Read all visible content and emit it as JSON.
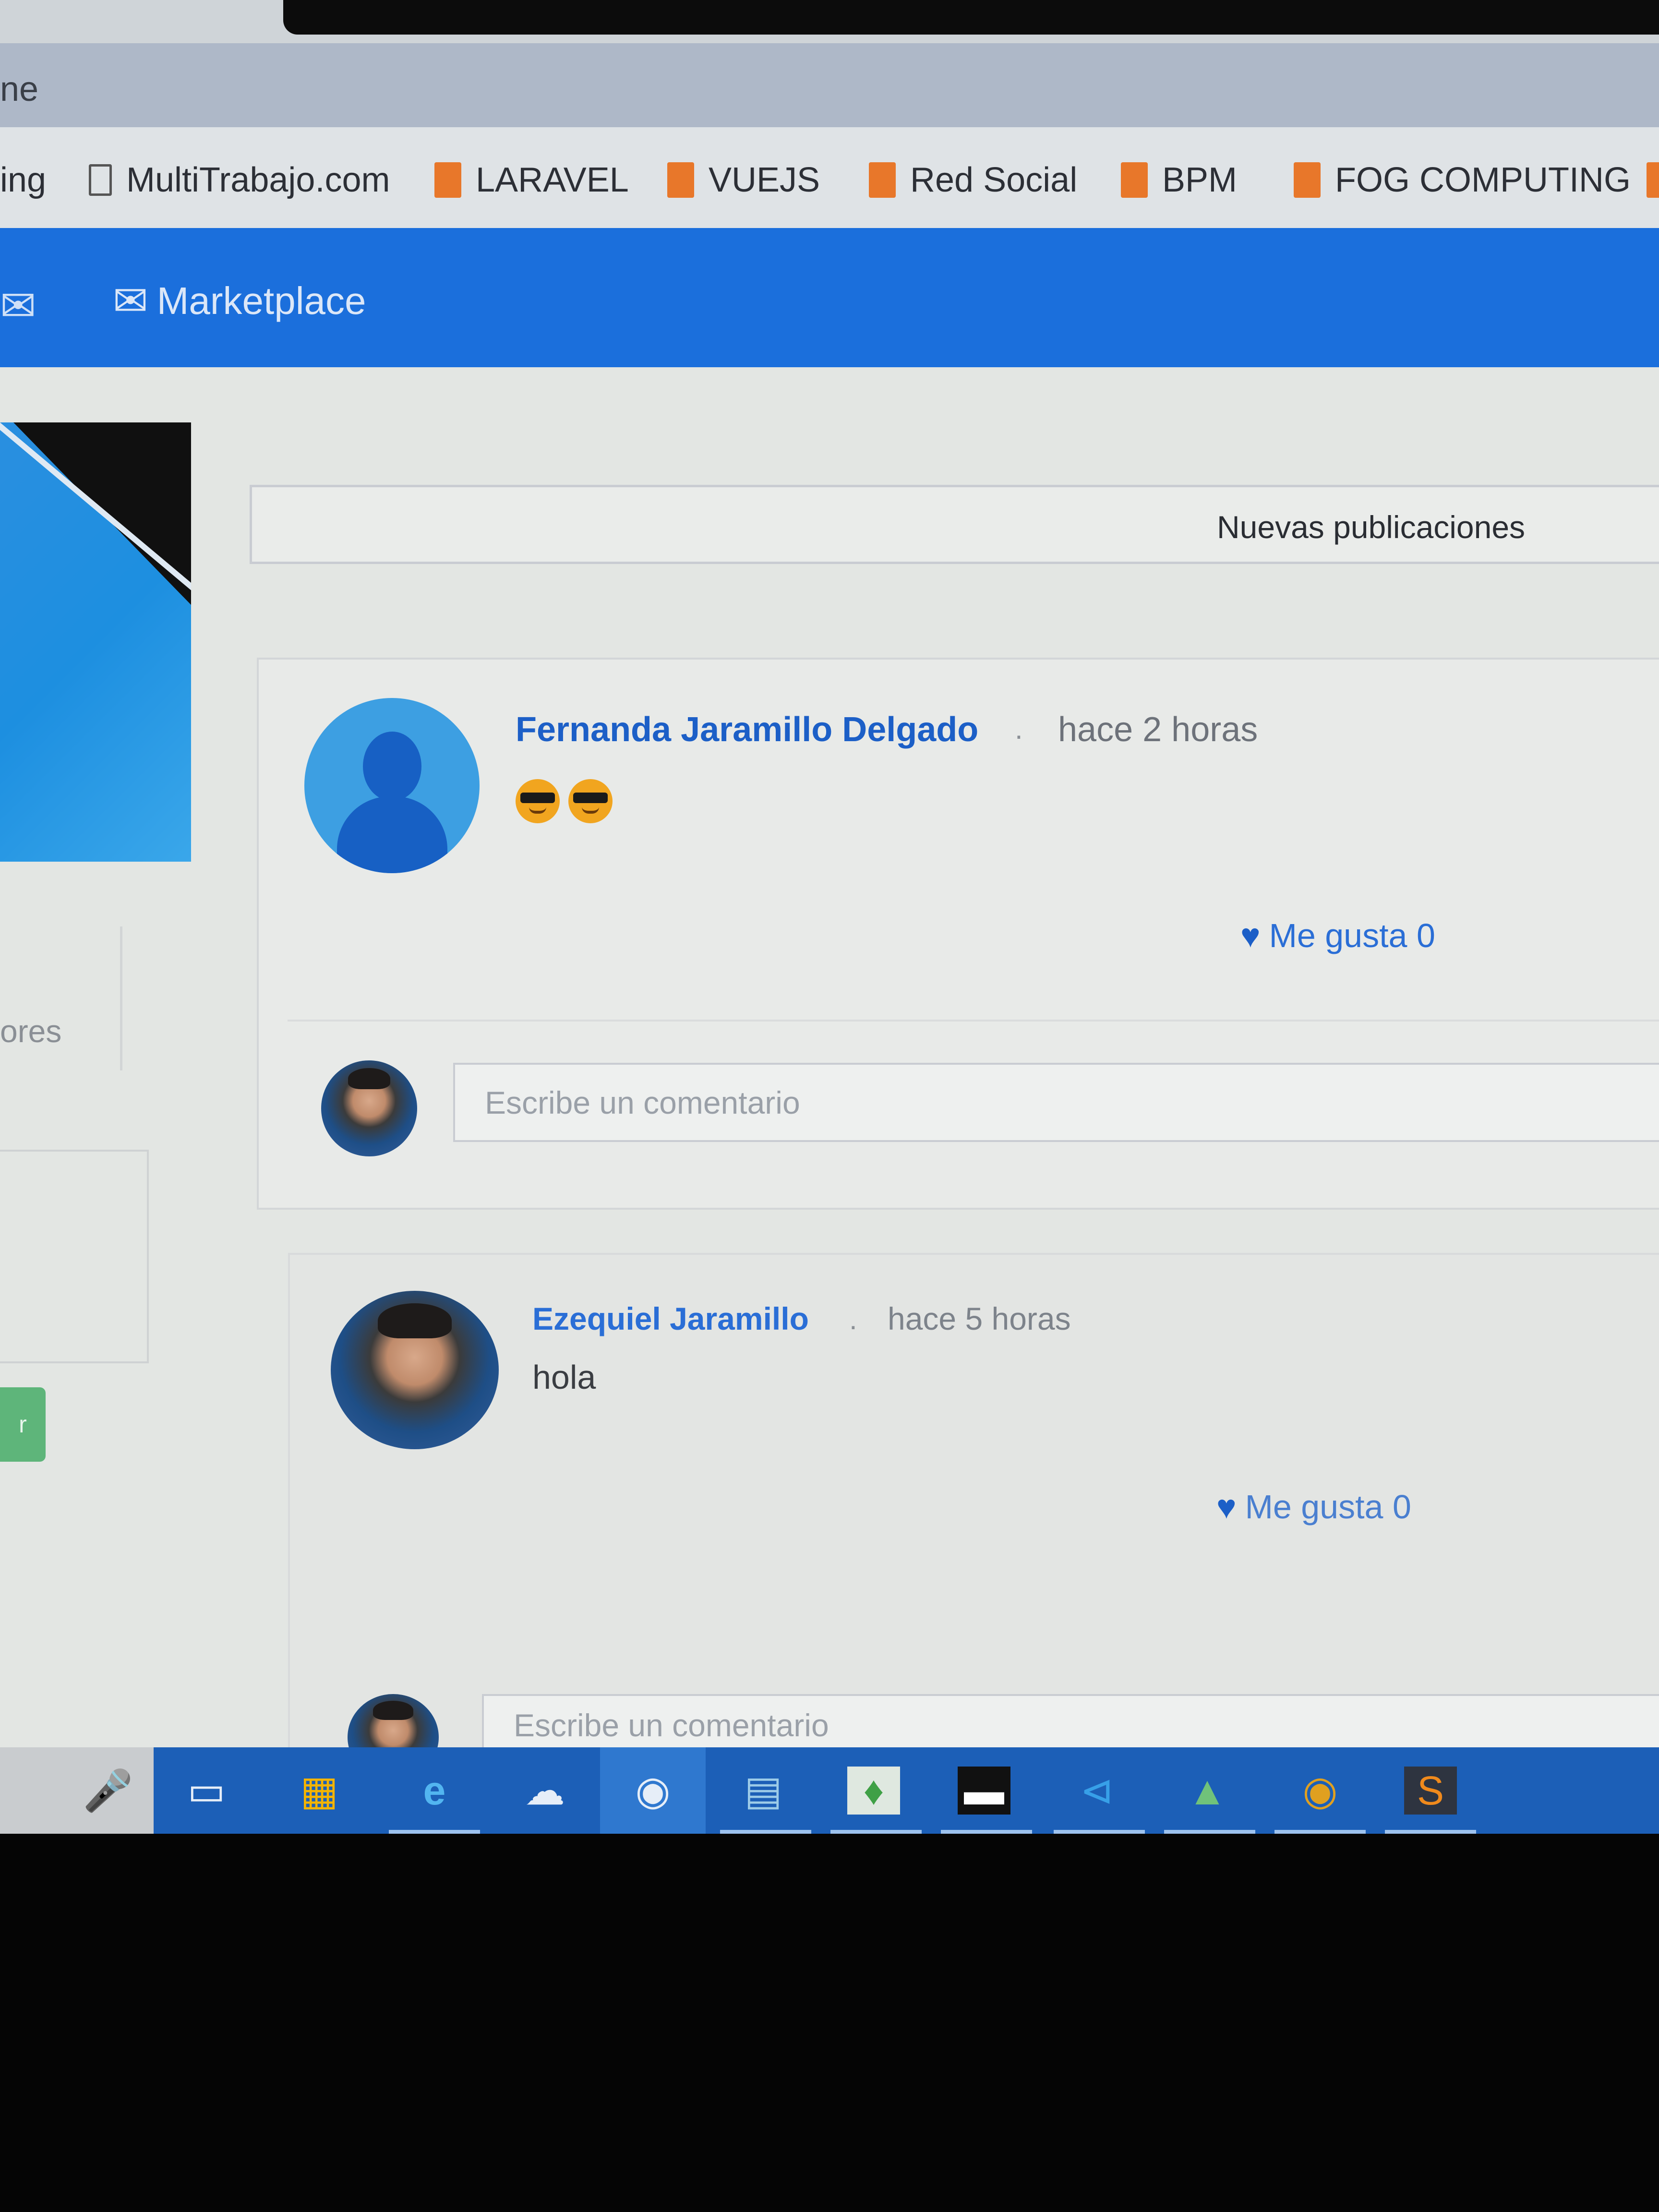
{
  "browser": {
    "title_fragment": "ne",
    "bookmarks": [
      {
        "label": "ing",
        "icon": "none"
      },
      {
        "label": "MultiTrabajo.com",
        "icon": "page-icon"
      },
      {
        "label": "LARAVEL",
        "icon": "folder-icon"
      },
      {
        "label": "VUEJS",
        "icon": "folder-icon"
      },
      {
        "label": "Red Social",
        "icon": "folder-icon"
      },
      {
        "label": "BPM",
        "icon": "folder-icon"
      },
      {
        "label": "FOG COMPUTING",
        "icon": "folder-icon"
      }
    ]
  },
  "navbar": {
    "mail_icon": "envelope-icon",
    "marketplace_label": "Marketplace",
    "color": "#1b6fdc"
  },
  "sidebar": {
    "stats_fragment": "ores",
    "button_fragment": "r"
  },
  "feed": {
    "header_label": "Nuevas publicaciones",
    "posts": [
      {
        "author": "Fernanda Jaramillo Delgado",
        "separator": ".",
        "time": "hace 2 horas",
        "content": "😎😎",
        "like_label": "Me gusta 0",
        "comment_placeholder": "Escribe un comentario"
      },
      {
        "author": "Ezequiel Jaramillo",
        "separator": ".",
        "time": "hace 5 horas",
        "content": "hola",
        "like_label": "Me gusta 0",
        "comment_placeholder": "Escribe un comentario"
      }
    ]
  },
  "taskbar": {
    "icons": [
      "microphone-icon",
      "task-view-icon",
      "store-icon",
      "edge-icon",
      "onedrive-files-icon",
      "chrome-icon",
      "file-explorer-icon",
      "mongodb-icon",
      "terminal-icon",
      "vscode-icon",
      "android-studio-icon",
      "chrome-icon",
      "sublime-icon"
    ],
    "color": "#1c5fb7"
  }
}
